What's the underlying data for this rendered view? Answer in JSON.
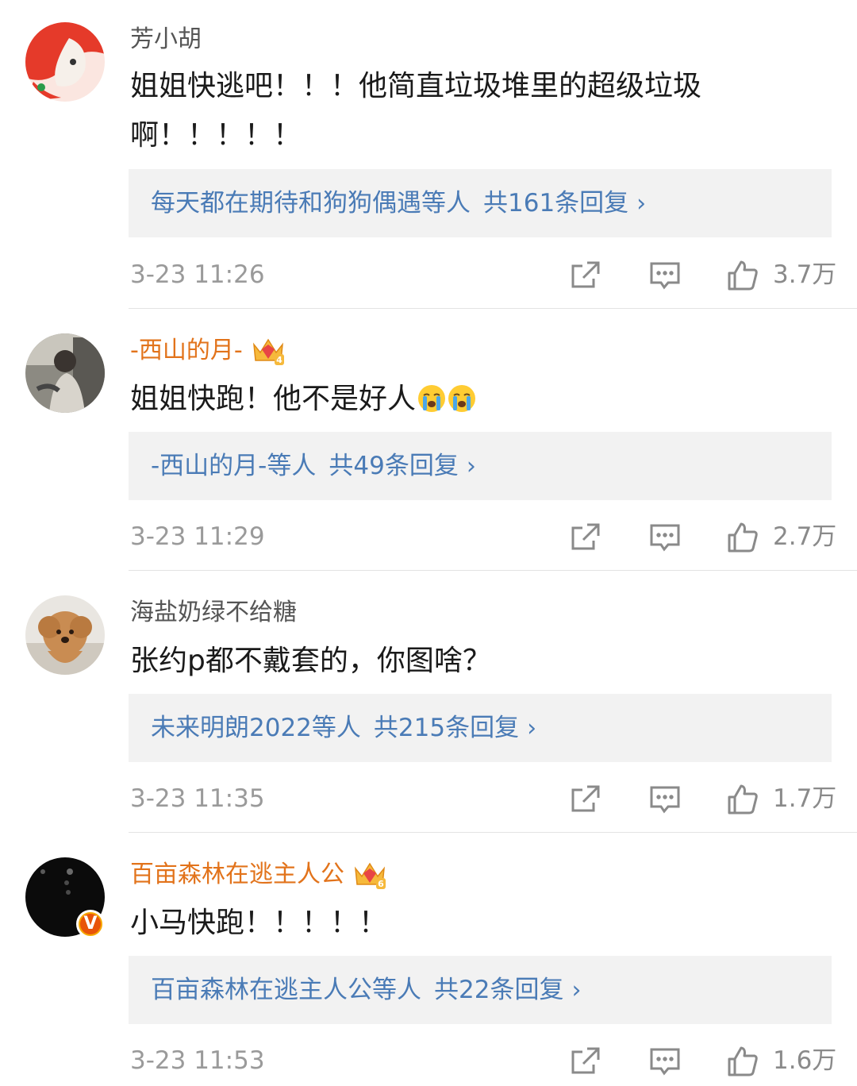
{
  "comments": [
    {
      "username": "芳小胡",
      "text_lines": [
        "姐姐快逃吧！！！他简直垃圾堆里的超级垃圾",
        "啊！！！！！"
      ],
      "reply_who": "每天都在期待和狗狗偶遇等人",
      "reply_count": "共161条回复",
      "time": "3-23 11:26",
      "likes": "3.7万"
    },
    {
      "username": "-西山的月-",
      "crown_level": "4",
      "text_lines": [
        "姐姐快跑！他不是好人"
      ],
      "reply_who": "-西山的月-等人",
      "reply_count": "共49条回复",
      "time": "3-23 11:29",
      "likes": "2.7万"
    },
    {
      "username": "海盐奶绿不给糖",
      "text_lines": [
        "张约p都不戴套的，你图啥？"
      ],
      "reply_who": "未来明朗2022等人",
      "reply_count": "共215条回复",
      "time": "3-23 11:35",
      "likes": "1.7万"
    },
    {
      "username": "百亩森林在逃主人公",
      "crown_level": "6",
      "verified_badge": "V",
      "text_lines": [
        "小马快跑！！！！！"
      ],
      "reply_who": "百亩森林在逃主人公等人",
      "reply_count": "共22条回复",
      "time": "3-23 11:53",
      "likes": "1.6万"
    }
  ],
  "reply_chevron": "›",
  "icons": {
    "share": "share-icon",
    "comment": "comment-icon",
    "like": "thumbs-up-icon",
    "crying": "loudly-crying-emoji",
    "crown": "vip-crown-icon"
  },
  "colors": {
    "link_blue": "#4a7bb6",
    "vip_orange": "#e2731b",
    "reply_bg": "#f2f2f2",
    "meta_gray": "#9a9a9a"
  }
}
